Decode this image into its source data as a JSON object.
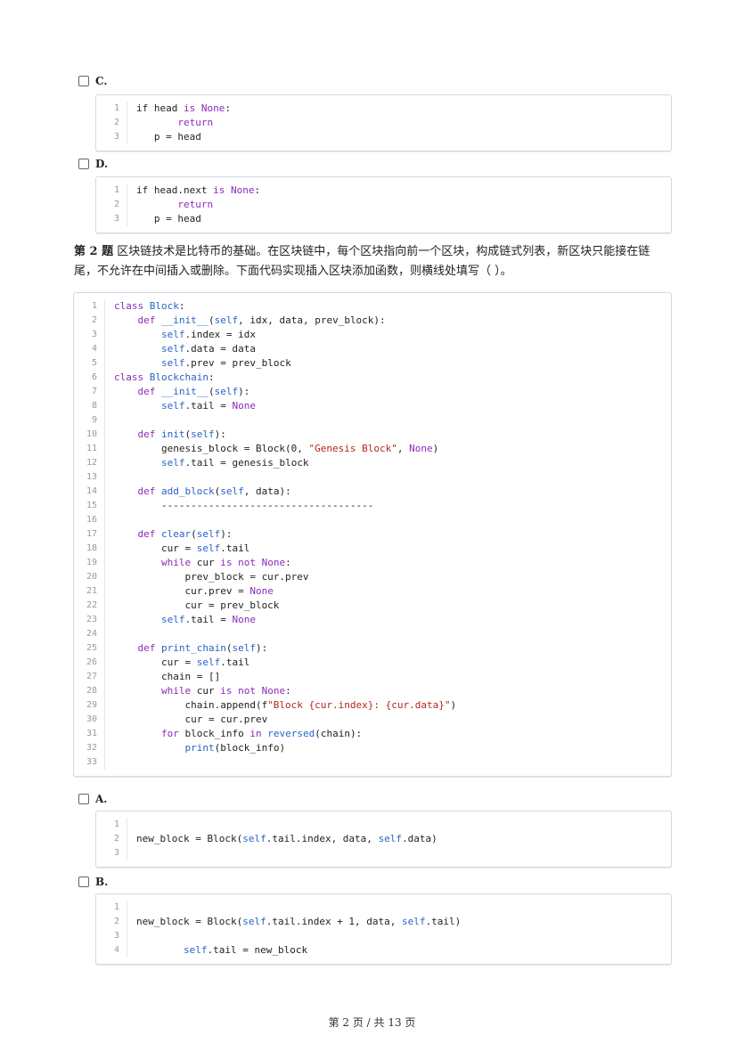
{
  "options_top": {
    "C": {
      "label": "C.",
      "lines": [
        [
          {
            "t": "if head "
          },
          {
            "t": "is",
            "c": "kw"
          },
          {
            "t": " "
          },
          {
            "t": "None",
            "c": "kw"
          },
          {
            "t": ":"
          }
        ],
        [
          {
            "t": "       "
          },
          {
            "t": "return",
            "c": "kw"
          }
        ],
        [
          {
            "t": "   p = head"
          }
        ]
      ]
    },
    "D": {
      "label": "D.",
      "lines": [
        [
          {
            "t": "if head.next "
          },
          {
            "t": "is",
            "c": "kw"
          },
          {
            "t": " "
          },
          {
            "t": "None",
            "c": "kw"
          },
          {
            "t": ":"
          }
        ],
        [
          {
            "t": "       "
          },
          {
            "t": "return",
            "c": "kw"
          }
        ],
        [
          {
            "t": "   p = head"
          }
        ]
      ]
    }
  },
  "question": {
    "number": "第 2 题",
    "text": "区块链技术是比特币的基础。在区块链中，每个区块指向前一个区块，构成链式列表，新区块只能接在链尾，不允许在中间插入或删除。下面代码实现插入区块添加函数，则横线处填写（    ）。"
  },
  "main_code": [
    [
      {
        "t": "class ",
        "c": "kw"
      },
      {
        "t": "Block",
        "c": "bl"
      },
      {
        "t": ":"
      }
    ],
    [
      {
        "t": "    "
      },
      {
        "t": "def ",
        "c": "kw"
      },
      {
        "t": "__init__",
        "c": "bl"
      },
      {
        "t": "("
      },
      {
        "t": "self",
        "c": "bl"
      },
      {
        "t": ", idx, data, prev_block):"
      }
    ],
    [
      {
        "t": "        "
      },
      {
        "t": "self",
        "c": "bl"
      },
      {
        "t": ".index = idx"
      }
    ],
    [
      {
        "t": "        "
      },
      {
        "t": "self",
        "c": "bl"
      },
      {
        "t": ".data = data"
      }
    ],
    [
      {
        "t": "        "
      },
      {
        "t": "self",
        "c": "bl"
      },
      {
        "t": ".prev = prev_block"
      }
    ],
    [
      {
        "t": "class ",
        "c": "kw"
      },
      {
        "t": "Blockchain",
        "c": "bl"
      },
      {
        "t": ":"
      }
    ],
    [
      {
        "t": "    "
      },
      {
        "t": "def ",
        "c": "kw"
      },
      {
        "t": "__init__",
        "c": "bl"
      },
      {
        "t": "("
      },
      {
        "t": "self",
        "c": "bl"
      },
      {
        "t": "):"
      }
    ],
    [
      {
        "t": "        "
      },
      {
        "t": "self",
        "c": "bl"
      },
      {
        "t": ".tail = "
      },
      {
        "t": "None",
        "c": "kw"
      }
    ],
    [],
    [
      {
        "t": "    "
      },
      {
        "t": "def ",
        "c": "kw"
      },
      {
        "t": "init",
        "c": "bl"
      },
      {
        "t": "("
      },
      {
        "t": "self",
        "c": "bl"
      },
      {
        "t": "):"
      }
    ],
    [
      {
        "t": "        genesis_block = Block(0, "
      },
      {
        "t": "\"Genesis Block\"",
        "c": "st"
      },
      {
        "t": ", "
      },
      {
        "t": "None",
        "c": "kw"
      },
      {
        "t": ")"
      }
    ],
    [
      {
        "t": "        "
      },
      {
        "t": "self",
        "c": "bl"
      },
      {
        "t": ".tail = genesis_block"
      }
    ],
    [],
    [
      {
        "t": "    "
      },
      {
        "t": "def ",
        "c": "kw"
      },
      {
        "t": "add_block",
        "c": "bl"
      },
      {
        "t": "("
      },
      {
        "t": "self",
        "c": "bl"
      },
      {
        "t": ", data):"
      }
    ],
    [
      {
        "t": "        ------------------------------------"
      }
    ],
    [],
    [
      {
        "t": "    "
      },
      {
        "t": "def ",
        "c": "kw"
      },
      {
        "t": "clear",
        "c": "bl"
      },
      {
        "t": "("
      },
      {
        "t": "self",
        "c": "bl"
      },
      {
        "t": "):"
      }
    ],
    [
      {
        "t": "        cur = "
      },
      {
        "t": "self",
        "c": "bl"
      },
      {
        "t": ".tail"
      }
    ],
    [
      {
        "t": "        "
      },
      {
        "t": "while",
        "c": "kw"
      },
      {
        "t": " cur "
      },
      {
        "t": "is not",
        "c": "kw"
      },
      {
        "t": " "
      },
      {
        "t": "None",
        "c": "kw"
      },
      {
        "t": ":"
      }
    ],
    [
      {
        "t": "            prev_block = cur.prev"
      }
    ],
    [
      {
        "t": "            cur.prev = "
      },
      {
        "t": "None",
        "c": "kw"
      }
    ],
    [
      {
        "t": "            cur = prev_block"
      }
    ],
    [
      {
        "t": "        "
      },
      {
        "t": "self",
        "c": "bl"
      },
      {
        "t": ".tail = "
      },
      {
        "t": "None",
        "c": "kw"
      }
    ],
    [],
    [
      {
        "t": "    "
      },
      {
        "t": "def ",
        "c": "kw"
      },
      {
        "t": "print_chain",
        "c": "bl"
      },
      {
        "t": "("
      },
      {
        "t": "self",
        "c": "bl"
      },
      {
        "t": "):"
      }
    ],
    [
      {
        "t": "        cur = "
      },
      {
        "t": "self",
        "c": "bl"
      },
      {
        "t": ".tail"
      }
    ],
    [
      {
        "t": "        chain = []"
      }
    ],
    [
      {
        "t": "        "
      },
      {
        "t": "while",
        "c": "kw"
      },
      {
        "t": " cur "
      },
      {
        "t": "is not",
        "c": "kw"
      },
      {
        "t": " "
      },
      {
        "t": "None",
        "c": "kw"
      },
      {
        "t": ":"
      }
    ],
    [
      {
        "t": "            chain.append(f"
      },
      {
        "t": "\"Block {cur.index}: {cur.data}\"",
        "c": "st"
      },
      {
        "t": ")"
      }
    ],
    [
      {
        "t": "            cur = cur.prev"
      }
    ],
    [
      {
        "t": "        "
      },
      {
        "t": "for",
        "c": "kw"
      },
      {
        "t": " block_info "
      },
      {
        "t": "in",
        "c": "kw"
      },
      {
        "t": " "
      },
      {
        "t": "reversed",
        "c": "bl"
      },
      {
        "t": "(chain):"
      }
    ],
    [
      {
        "t": "            "
      },
      {
        "t": "print",
        "c": "bl"
      },
      {
        "t": "(block_info)"
      }
    ],
    []
  ],
  "options_bottom": {
    "A": {
      "label": "A.",
      "lines": [
        [],
        [
          {
            "t": "new_block = Block("
          },
          {
            "t": "self",
            "c": "bl"
          },
          {
            "t": ".tail.index, data, "
          },
          {
            "t": "self",
            "c": "bl"
          },
          {
            "t": ".data)"
          }
        ],
        []
      ]
    },
    "B": {
      "label": "B.",
      "lines": [
        [],
        [
          {
            "t": "new_block = Block("
          },
          {
            "t": "self",
            "c": "bl"
          },
          {
            "t": ".tail.index + 1, data, "
          },
          {
            "t": "self",
            "c": "bl"
          },
          {
            "t": ".tail)"
          }
        ],
        [],
        [
          {
            "t": "        "
          },
          {
            "t": "self",
            "c": "bl"
          },
          {
            "t": ".tail = new_block"
          }
        ]
      ]
    }
  },
  "footer": "第 2 页 / 共 13 页"
}
